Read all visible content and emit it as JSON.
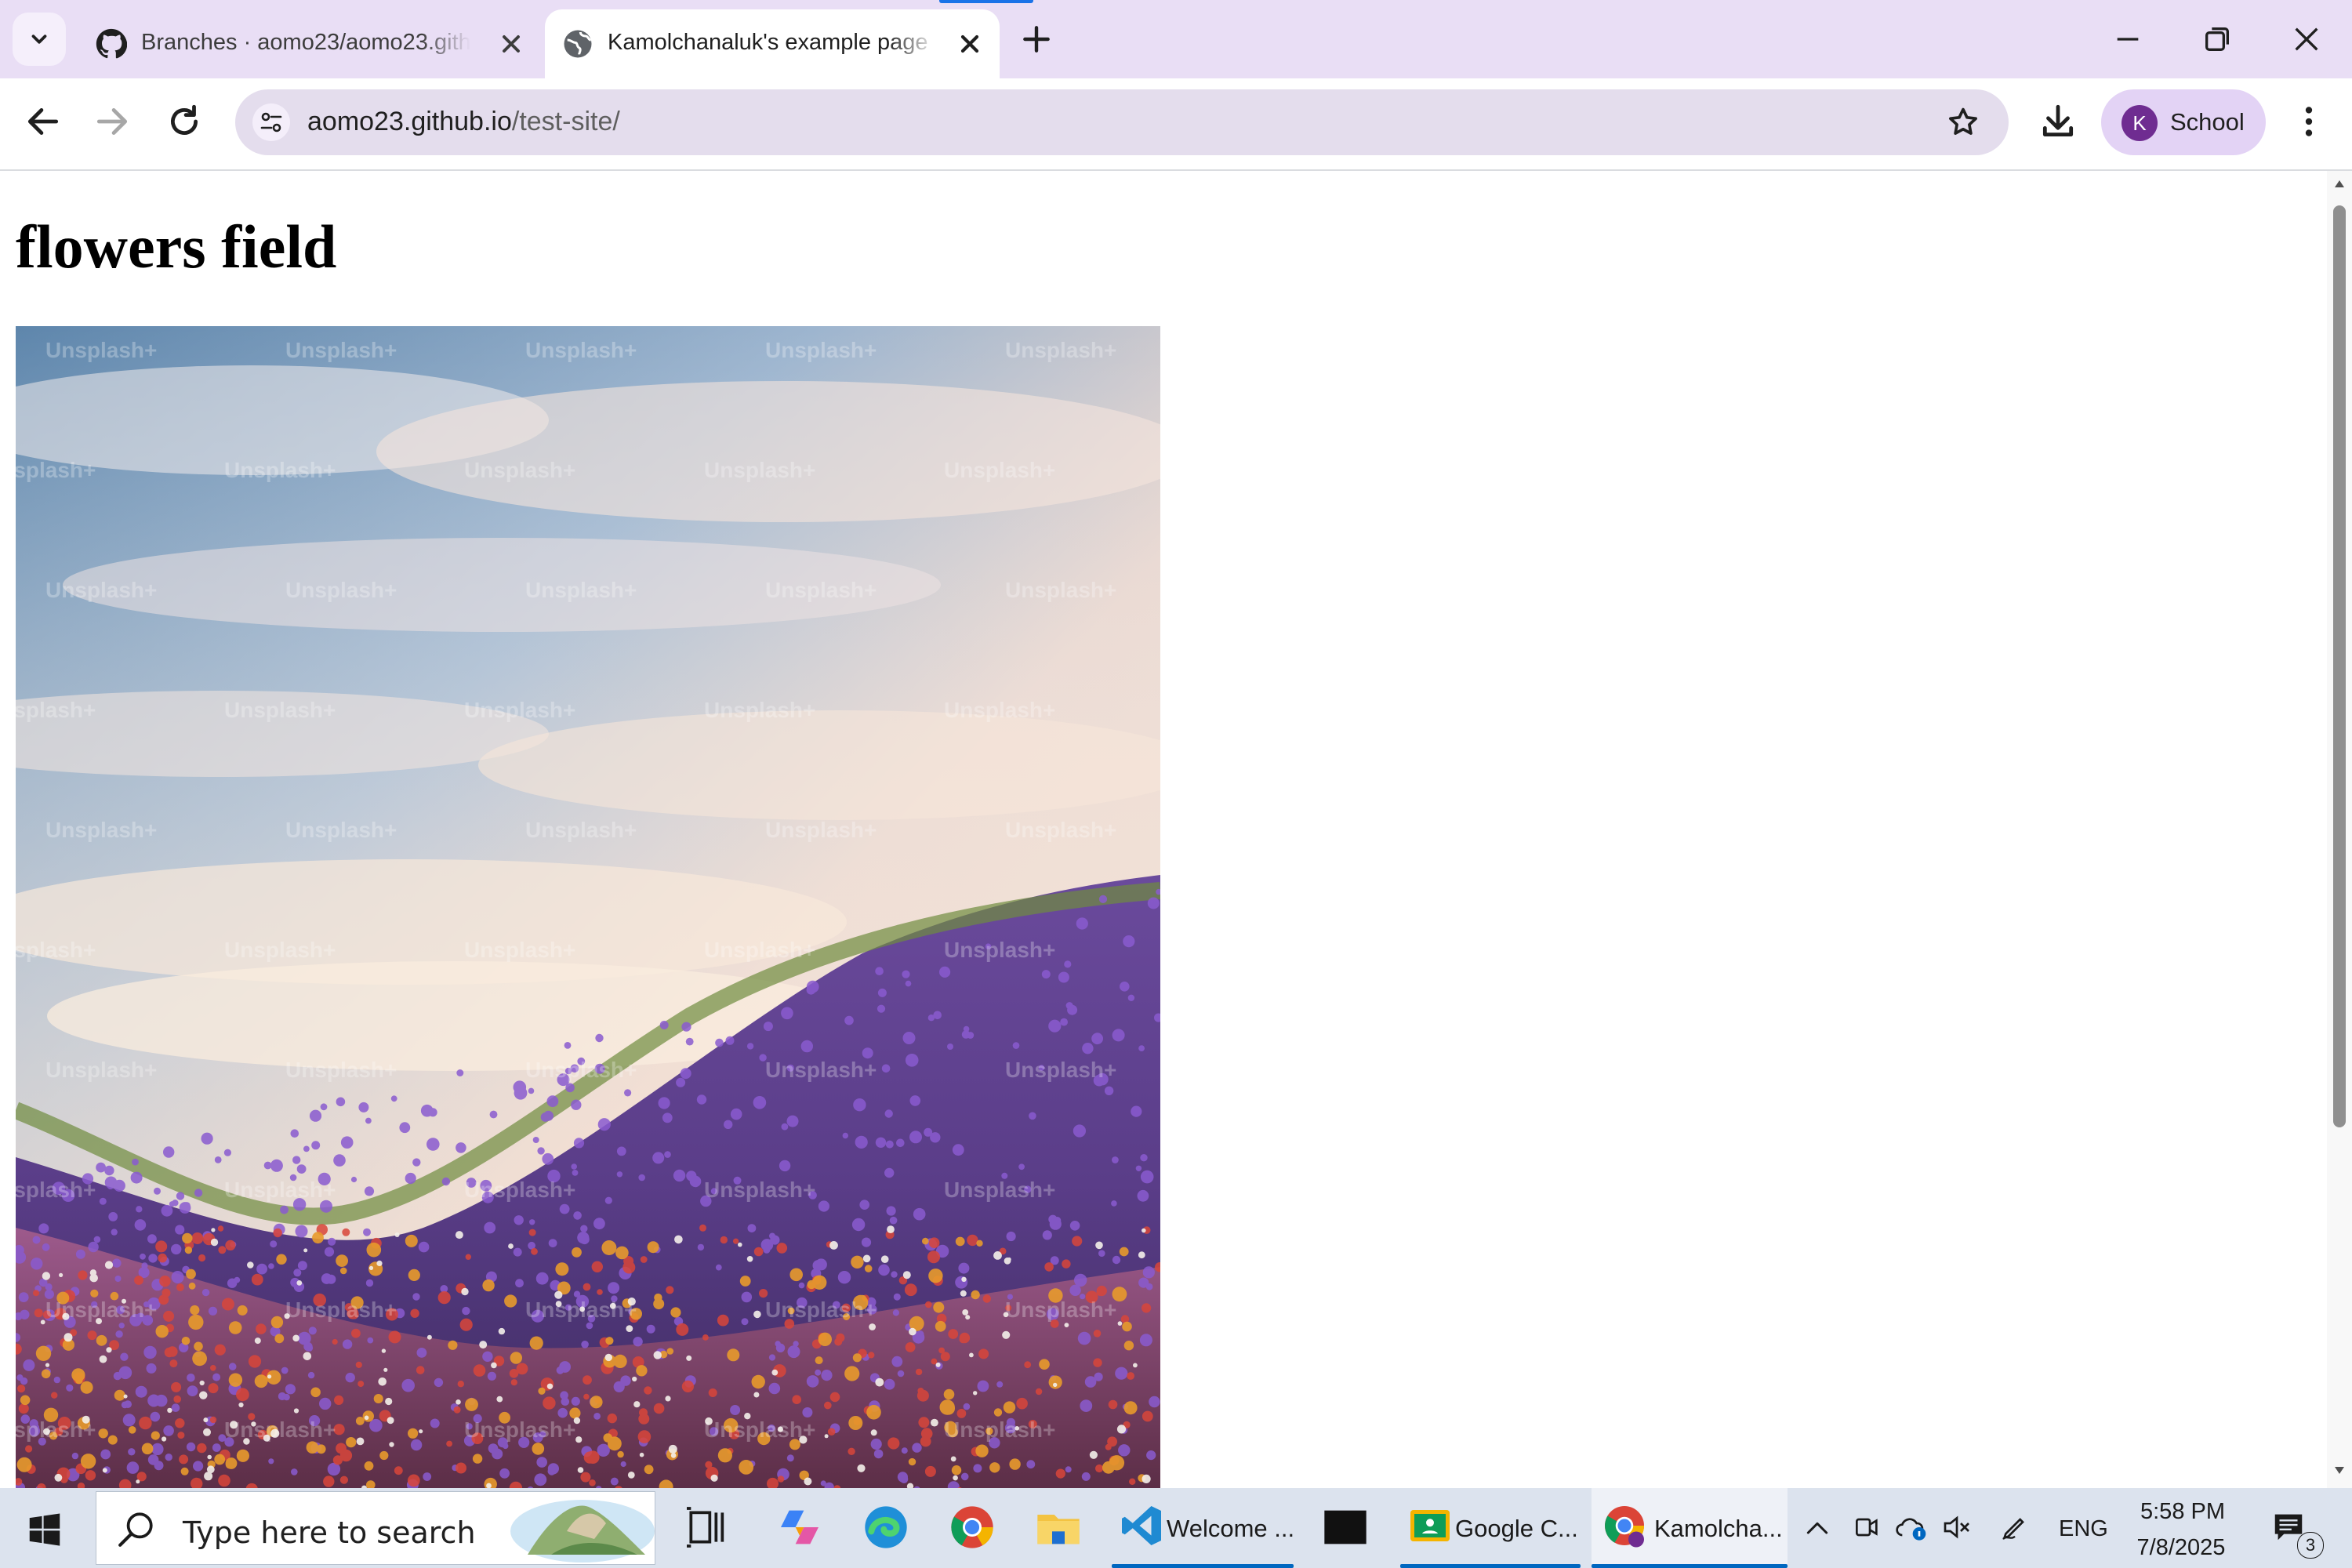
{
  "browser": {
    "tabs": [
      {
        "title": "Branches · aomo23/aomo23.github.io",
        "active": false,
        "icon": "github-icon"
      },
      {
        "title": "Kamolchanaluk's example page",
        "active": true,
        "icon": "globe-icon"
      }
    ],
    "address": {
      "host": "aomo23.github.io",
      "path": "/test-site/"
    },
    "profile": {
      "initial": "K",
      "label": "School"
    },
    "accent_color": "#1a73e8",
    "frame_color": "#e9def5"
  },
  "page": {
    "heading": "flowers field",
    "image": {
      "alt": "Hillside covered in purple, red, orange and white wildflowers under a cloudy sky",
      "watermark": "Unsplash+"
    }
  },
  "taskbar": {
    "search_placeholder": "Type here to search",
    "apps": [
      {
        "label": "Welcome ...",
        "icon": "vscode-icon"
      },
      {
        "label": "Google C...",
        "icon": "google-classroom-icon"
      },
      {
        "label": "Kamolcha...",
        "icon": "chrome-icon"
      }
    ],
    "tray": {
      "language": "ENG",
      "time": "5:58 PM",
      "date": "7/8/2025",
      "notification_count": "3"
    }
  }
}
